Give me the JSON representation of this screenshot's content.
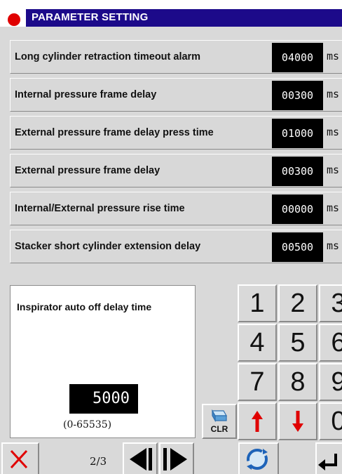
{
  "title": "PARAMETER SETTING",
  "colors": {
    "title_band": "#1c0a8a",
    "status_dot": "#e00000",
    "arrow": "#e00000",
    "cancel": "#e00000",
    "refresh": "#1e63b8"
  },
  "params": [
    {
      "label": "Long cylinder retraction timeout alarm",
      "value": "04000",
      "unit": "ms"
    },
    {
      "label": "Internal pressure frame delay",
      "value": "00300",
      "unit": "ms"
    },
    {
      "label": "External pressure frame delay press time",
      "value": "01000",
      "unit": "ms"
    },
    {
      "label": "External pressure frame delay",
      "value": "00300",
      "unit": "ms"
    },
    {
      "label": "Internal/External pressure rise time",
      "value": "00000",
      "unit": "ms"
    },
    {
      "label": "Stacker short cylinder extension delay",
      "value": "00500",
      "unit": "ms"
    }
  ],
  "info": {
    "description": "Inspirator auto off delay time",
    "value": "5000",
    "range": "(0-65535)"
  },
  "keypad": {
    "keys": [
      "1",
      "2",
      "3",
      "4",
      "5",
      "6",
      "7",
      "8",
      "9",
      "0"
    ],
    "clear_label": "CLR",
    "up_icon": "up-arrow-icon",
    "down_icon": "down-arrow-icon"
  },
  "footer": {
    "page": "2/3",
    "cancel_icon": "close-icon",
    "prev_icon": "prev-page-icon",
    "next_icon": "next-page-icon",
    "refresh_icon": "refresh-icon",
    "enter_icon": "enter-icon"
  }
}
